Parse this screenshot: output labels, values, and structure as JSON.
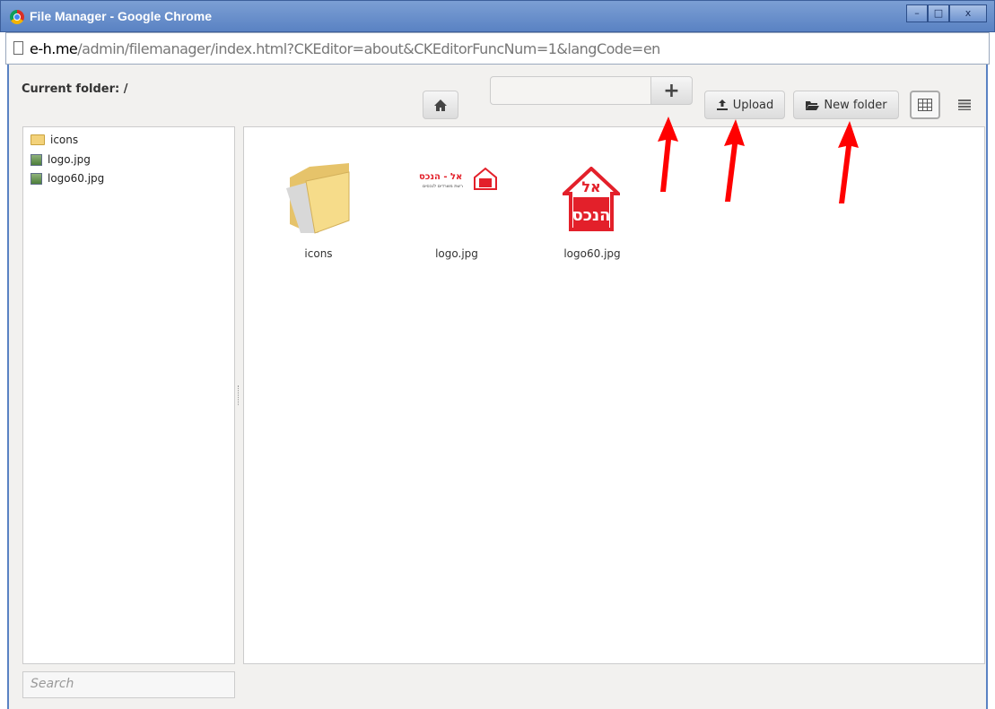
{
  "window": {
    "title": "File Manager - Google Chrome",
    "buttons": {
      "minimize": "–",
      "maximize": "□",
      "close": "x"
    }
  },
  "address": {
    "domain": "e-h.me",
    "path": "/admin/filemanager/index.html?CKEditor=about&CKEditorFuncNum=1&langCode=en"
  },
  "toolbar": {
    "current_folder_label": "Current folder:",
    "current_folder_value": "/",
    "plus_label": "+",
    "upload_label": "Upload",
    "new_folder_label": "New folder"
  },
  "tree": [
    {
      "label": "icons",
      "type": "folder"
    },
    {
      "label": "logo.jpg",
      "type": "image"
    },
    {
      "label": "logo60.jpg",
      "type": "image"
    }
  ],
  "files": [
    {
      "name": "icons",
      "type": "folder"
    },
    {
      "name": "logo.jpg",
      "type": "image",
      "logo_text": "אל - הנכס",
      "logo_subtext": "רשת משרדים לנכסים"
    },
    {
      "name": "logo60.jpg",
      "type": "image",
      "logo_text": "אל",
      "logo_subtext": "הנכס"
    }
  ],
  "search": {
    "placeholder": "Search"
  },
  "colors": {
    "arrow": "#ff0000",
    "titlebar": "#5a82c3",
    "logo": "#e3202a"
  }
}
